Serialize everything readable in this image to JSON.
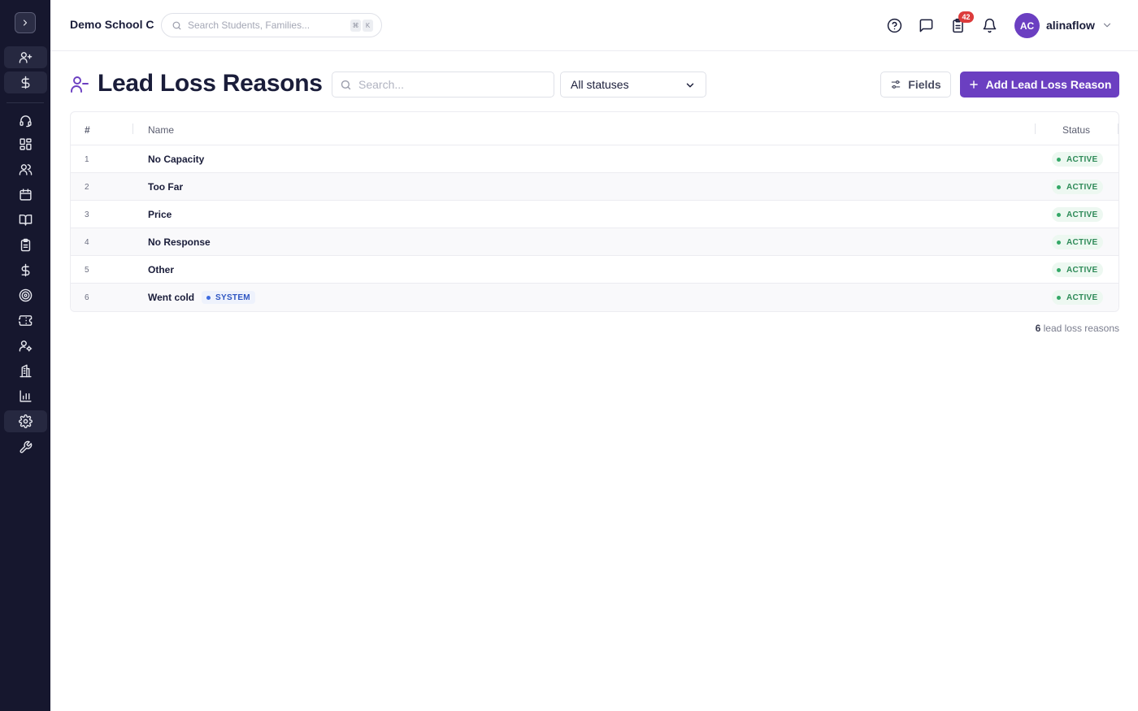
{
  "topbar": {
    "school_name": "Demo School C",
    "search_placeholder": "Search Students, Families...",
    "shortcut_key_1": "⌘",
    "shortcut_key_2": "K",
    "tasks_badge": "42",
    "user_initials": "AC",
    "username": "alinaflow"
  },
  "page": {
    "title": "Lead Loss Reasons",
    "search_placeholder": "Search...",
    "status_filter": "All statuses",
    "fields_label": "Fields",
    "add_label": "Add Lead Loss Reason"
  },
  "table": {
    "headers": {
      "num": "#",
      "name": "Name",
      "status": "Status"
    },
    "rows": [
      {
        "num": "1",
        "name": "No Capacity",
        "status": "ACTIVE"
      },
      {
        "num": "2",
        "name": "Too Far",
        "status": "ACTIVE"
      },
      {
        "num": "3",
        "name": "Price",
        "status": "ACTIVE"
      },
      {
        "num": "4",
        "name": "No Response",
        "status": "ACTIVE"
      },
      {
        "num": "5",
        "name": "Other",
        "status": "ACTIVE"
      },
      {
        "num": "6",
        "name": "Went cold",
        "tag": "SYSTEM",
        "status": "ACTIVE"
      }
    ]
  },
  "footer": {
    "count": "6",
    "count_label": "lead loss reasons"
  },
  "colors": {
    "accent": "#6b3fc1",
    "sidebar": "#16172e",
    "active": "#2e8a58",
    "system": "#2e55c2",
    "badge": "#dc3b3b"
  }
}
